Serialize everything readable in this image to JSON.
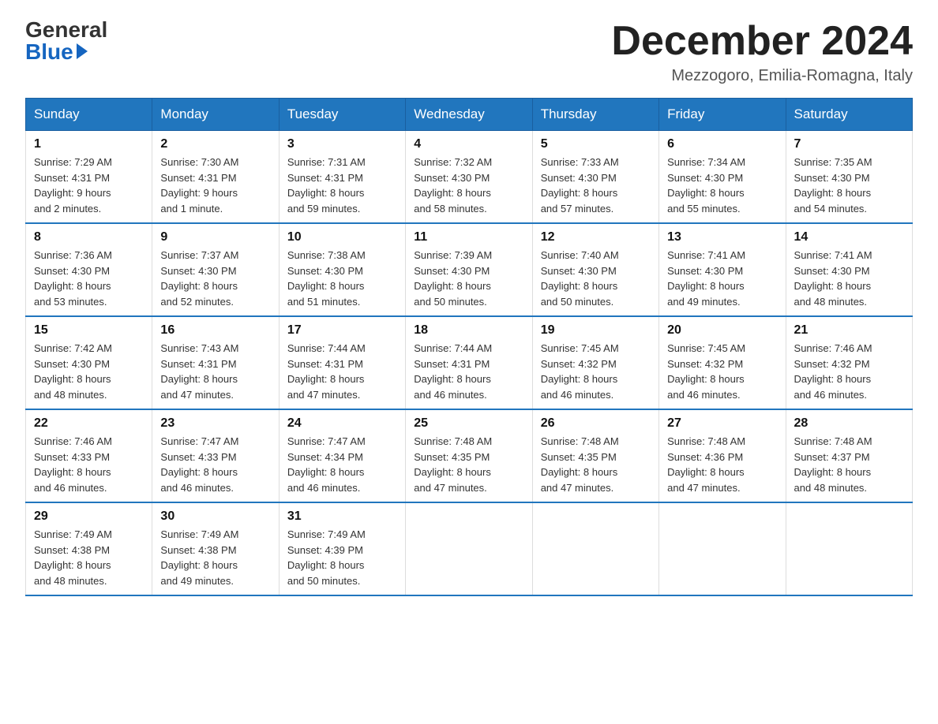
{
  "header": {
    "logo_general": "General",
    "logo_blue": "Blue",
    "month_title": "December 2024",
    "location": "Mezzogoro, Emilia-Romagna, Italy"
  },
  "days_of_week": [
    "Sunday",
    "Monday",
    "Tuesday",
    "Wednesday",
    "Thursday",
    "Friday",
    "Saturday"
  ],
  "weeks": [
    [
      {
        "day": "1",
        "sunrise": "7:29 AM",
        "sunset": "4:31 PM",
        "daylight": "9 hours and 2 minutes."
      },
      {
        "day": "2",
        "sunrise": "7:30 AM",
        "sunset": "4:31 PM",
        "daylight": "9 hours and 1 minute."
      },
      {
        "day": "3",
        "sunrise": "7:31 AM",
        "sunset": "4:31 PM",
        "daylight": "8 hours and 59 minutes."
      },
      {
        "day": "4",
        "sunrise": "7:32 AM",
        "sunset": "4:30 PM",
        "daylight": "8 hours and 58 minutes."
      },
      {
        "day": "5",
        "sunrise": "7:33 AM",
        "sunset": "4:30 PM",
        "daylight": "8 hours and 57 minutes."
      },
      {
        "day": "6",
        "sunrise": "7:34 AM",
        "sunset": "4:30 PM",
        "daylight": "8 hours and 55 minutes."
      },
      {
        "day": "7",
        "sunrise": "7:35 AM",
        "sunset": "4:30 PM",
        "daylight": "8 hours and 54 minutes."
      }
    ],
    [
      {
        "day": "8",
        "sunrise": "7:36 AM",
        "sunset": "4:30 PM",
        "daylight": "8 hours and 53 minutes."
      },
      {
        "day": "9",
        "sunrise": "7:37 AM",
        "sunset": "4:30 PM",
        "daylight": "8 hours and 52 minutes."
      },
      {
        "day": "10",
        "sunrise": "7:38 AM",
        "sunset": "4:30 PM",
        "daylight": "8 hours and 51 minutes."
      },
      {
        "day": "11",
        "sunrise": "7:39 AM",
        "sunset": "4:30 PM",
        "daylight": "8 hours and 50 minutes."
      },
      {
        "day": "12",
        "sunrise": "7:40 AM",
        "sunset": "4:30 PM",
        "daylight": "8 hours and 50 minutes."
      },
      {
        "day": "13",
        "sunrise": "7:41 AM",
        "sunset": "4:30 PM",
        "daylight": "8 hours and 49 minutes."
      },
      {
        "day": "14",
        "sunrise": "7:41 AM",
        "sunset": "4:30 PM",
        "daylight": "8 hours and 48 minutes."
      }
    ],
    [
      {
        "day": "15",
        "sunrise": "7:42 AM",
        "sunset": "4:30 PM",
        "daylight": "8 hours and 48 minutes."
      },
      {
        "day": "16",
        "sunrise": "7:43 AM",
        "sunset": "4:31 PM",
        "daylight": "8 hours and 47 minutes."
      },
      {
        "day": "17",
        "sunrise": "7:44 AM",
        "sunset": "4:31 PM",
        "daylight": "8 hours and 47 minutes."
      },
      {
        "day": "18",
        "sunrise": "7:44 AM",
        "sunset": "4:31 PM",
        "daylight": "8 hours and 46 minutes."
      },
      {
        "day": "19",
        "sunrise": "7:45 AM",
        "sunset": "4:32 PM",
        "daylight": "8 hours and 46 minutes."
      },
      {
        "day": "20",
        "sunrise": "7:45 AM",
        "sunset": "4:32 PM",
        "daylight": "8 hours and 46 minutes."
      },
      {
        "day": "21",
        "sunrise": "7:46 AM",
        "sunset": "4:32 PM",
        "daylight": "8 hours and 46 minutes."
      }
    ],
    [
      {
        "day": "22",
        "sunrise": "7:46 AM",
        "sunset": "4:33 PM",
        "daylight": "8 hours and 46 minutes."
      },
      {
        "day": "23",
        "sunrise": "7:47 AM",
        "sunset": "4:33 PM",
        "daylight": "8 hours and 46 minutes."
      },
      {
        "day": "24",
        "sunrise": "7:47 AM",
        "sunset": "4:34 PM",
        "daylight": "8 hours and 46 minutes."
      },
      {
        "day": "25",
        "sunrise": "7:48 AM",
        "sunset": "4:35 PM",
        "daylight": "8 hours and 47 minutes."
      },
      {
        "day": "26",
        "sunrise": "7:48 AM",
        "sunset": "4:35 PM",
        "daylight": "8 hours and 47 minutes."
      },
      {
        "day": "27",
        "sunrise": "7:48 AM",
        "sunset": "4:36 PM",
        "daylight": "8 hours and 47 minutes."
      },
      {
        "day": "28",
        "sunrise": "7:48 AM",
        "sunset": "4:37 PM",
        "daylight": "8 hours and 48 minutes."
      }
    ],
    [
      {
        "day": "29",
        "sunrise": "7:49 AM",
        "sunset": "4:38 PM",
        "daylight": "8 hours and 48 minutes."
      },
      {
        "day": "30",
        "sunrise": "7:49 AM",
        "sunset": "4:38 PM",
        "daylight": "8 hours and 49 minutes."
      },
      {
        "day": "31",
        "sunrise": "7:49 AM",
        "sunset": "4:39 PM",
        "daylight": "8 hours and 50 minutes."
      },
      null,
      null,
      null,
      null
    ]
  ]
}
